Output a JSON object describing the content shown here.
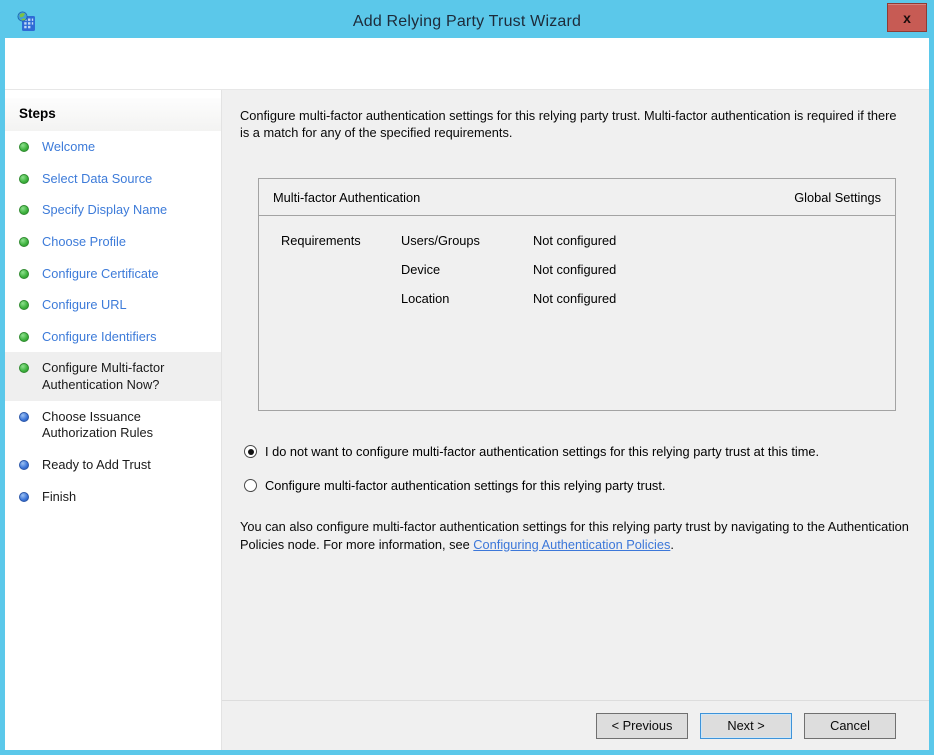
{
  "window": {
    "title": "Add Relying Party Trust Wizard",
    "close_glyph": "x"
  },
  "sidebar": {
    "header": "Steps",
    "steps": [
      {
        "label": "Welcome",
        "state": "done"
      },
      {
        "label": "Select Data Source",
        "state": "done"
      },
      {
        "label": "Specify Display Name",
        "state": "done"
      },
      {
        "label": "Choose Profile",
        "state": "done"
      },
      {
        "label": "Configure Certificate",
        "state": "done"
      },
      {
        "label": "Configure URL",
        "state": "done"
      },
      {
        "label": "Configure Identifiers",
        "state": "done"
      },
      {
        "label": "Configure Multi-factor Authentication Now?",
        "state": "current"
      },
      {
        "label": "Choose Issuance Authorization Rules",
        "state": "upcoming"
      },
      {
        "label": "Ready to Add Trust",
        "state": "upcoming"
      },
      {
        "label": "Finish",
        "state": "upcoming"
      }
    ]
  },
  "main": {
    "intro": "Configure multi-factor authentication settings for this relying party trust. Multi-factor authentication is required if there is a match for any of the specified requirements.",
    "table": {
      "header_left": "Multi-factor Authentication",
      "header_right": "Global Settings",
      "group_label": "Requirements",
      "rows": [
        {
          "name": "Users/Groups",
          "value": "Not configured"
        },
        {
          "name": "Device",
          "value": "Not configured"
        },
        {
          "name": "Location",
          "value": "Not configured"
        }
      ]
    },
    "radios": [
      {
        "label": "I do not want to configure multi-factor authentication settings for this relying party trust at this time.",
        "selected": true
      },
      {
        "label": "Configure multi-factor authentication settings for this relying party trust.",
        "selected": false
      }
    ],
    "footer": {
      "text_before": "You can also configure multi-factor authentication settings for this relying party trust by navigating to the Authentication Policies node. For more information, see ",
      "link": "Configuring Authentication Policies",
      "text_after": "."
    }
  },
  "buttons": {
    "previous": "< Previous",
    "next": "Next >",
    "cancel": "Cancel"
  },
  "colors": {
    "titlebar": "#5BC8EA",
    "window_border": "#5BC8EA",
    "close_button": "#C75B54",
    "done_bullet": "#3DB23D",
    "upcoming_bullet": "#3A74D9",
    "step_link": "#3D7BD9",
    "link": "#3C77D9",
    "main_bg": "#F0F0F0",
    "sidebar_bg": "#FFFFFF",
    "next_button_border": "#3E93D9"
  }
}
